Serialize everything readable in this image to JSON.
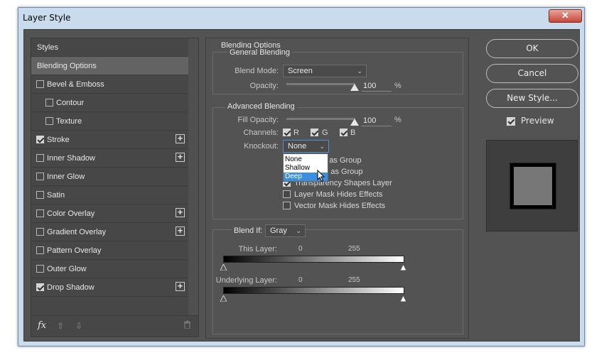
{
  "window": {
    "title": "Layer Style",
    "close_glyph": "✕"
  },
  "styles_panel": {
    "items": [
      {
        "label": "Styles",
        "checkbox": false,
        "checked": false,
        "plus": false,
        "selected": false
      },
      {
        "label": "Blending Options",
        "checkbox": false,
        "checked": false,
        "plus": false,
        "selected": true
      },
      {
        "label": "Bevel & Emboss",
        "checkbox": true,
        "checked": false,
        "plus": false,
        "selected": false
      },
      {
        "label": "Contour",
        "checkbox": true,
        "checked": false,
        "plus": false,
        "selected": false,
        "indent": true
      },
      {
        "label": "Texture",
        "checkbox": true,
        "checked": false,
        "plus": false,
        "selected": false,
        "indent": true
      },
      {
        "label": "Stroke",
        "checkbox": true,
        "checked": true,
        "plus": true,
        "selected": false
      },
      {
        "label": "Inner Shadow",
        "checkbox": true,
        "checked": false,
        "plus": true,
        "selected": false
      },
      {
        "label": "Inner Glow",
        "checkbox": true,
        "checked": false,
        "plus": false,
        "selected": false
      },
      {
        "label": "Satin",
        "checkbox": true,
        "checked": false,
        "plus": false,
        "selected": false
      },
      {
        "label": "Color Overlay",
        "checkbox": true,
        "checked": false,
        "plus": true,
        "selected": false
      },
      {
        "label": "Gradient Overlay",
        "checkbox": true,
        "checked": false,
        "plus": true,
        "selected": false
      },
      {
        "label": "Pattern Overlay",
        "checkbox": true,
        "checked": false,
        "plus": false,
        "selected": false
      },
      {
        "label": "Outer Glow",
        "checkbox": true,
        "checked": false,
        "plus": false,
        "selected": false
      },
      {
        "label": "Drop Shadow",
        "checkbox": true,
        "checked": true,
        "plus": true,
        "selected": false
      }
    ],
    "footer": {
      "fx": "fx",
      "up": "⇧",
      "down": "⇩",
      "trash": "🗑"
    }
  },
  "blending_options": {
    "title": "Blending Options",
    "general": {
      "title": "General Blending",
      "blend_mode_label": "Blend Mode:",
      "blend_mode_value": "Screen",
      "opacity_label": "Opacity:",
      "opacity_value": "100",
      "opacity_unit": "%",
      "opacity_level": 1.0
    },
    "advanced": {
      "title": "Advanced Blending",
      "fill_opacity_label": "Fill Opacity:",
      "fill_opacity_value": "100",
      "fill_opacity_unit": "%",
      "fill_opacity_level": 1.0,
      "channels_label": "Channels:",
      "channels": [
        {
          "label": "R",
          "checked": true
        },
        {
          "label": "G",
          "checked": true
        },
        {
          "label": "B",
          "checked": true
        }
      ],
      "knockout_label": "Knockout:",
      "knockout_value": "None",
      "knockout_options": [
        "None",
        "Shallow",
        "Deep"
      ],
      "knockout_highlighted": "Deep",
      "checkbox_options": [
        {
          "label": "or Effects as Group",
          "checked": false
        },
        {
          "label": "ed Layers as Group",
          "checked": false
        },
        {
          "label": "Transparency Shapes Layer",
          "checked": true
        },
        {
          "label": "Layer Mask Hides Effects",
          "checked": false
        },
        {
          "label": "Vector Mask Hides Effects",
          "checked": false
        }
      ]
    },
    "blend_if": {
      "label": "Blend If:",
      "value": "Gray",
      "this_layer_label": "This Layer:",
      "this_layer_min": "0",
      "this_layer_max": "255",
      "underlying_label": "Underlying Layer:",
      "underlying_min": "0",
      "underlying_max": "255"
    }
  },
  "buttons": {
    "ok": "OK",
    "cancel": "Cancel",
    "new_style": "New Style..."
  },
  "preview": {
    "label": "Preview",
    "checked": true
  }
}
